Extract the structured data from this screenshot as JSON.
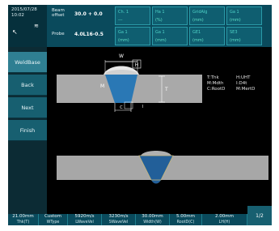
{
  "header": {
    "date": "2015/07/28",
    "time": "10:02",
    "beam_offset_label": "Beam\noffset",
    "beam_offset_value": "30.0 + 0.0",
    "probe_label": "Probe",
    "probe_value": "4.0L16-0.5",
    "tiles": [
      {
        "title": "Ch. 1",
        "value": "---"
      },
      {
        "title": "Ha 1",
        "value": "(%)"
      },
      {
        "title": "GridAlg",
        "value": "(mm)"
      },
      {
        "title": "Ga 1",
        "value": "(mm)"
      },
      {
        "title": "Ga 1",
        "value": "(mm)"
      },
      {
        "title": "Ga 1",
        "value": "(mm)"
      },
      {
        "title": "GE1",
        "value": "(mm)"
      },
      {
        "title": "SE3",
        "value": "(mm)"
      }
    ]
  },
  "sidebar": {
    "items": [
      {
        "label": "WeldBase"
      },
      {
        "label": "Back"
      },
      {
        "label": "Next"
      },
      {
        "label": "Finish"
      }
    ]
  },
  "diagram": {
    "labels": {
      "w": "W",
      "h": "H",
      "m": "M",
      "t": "T",
      "c": "C",
      "i": "I"
    },
    "legend": {
      "left": [
        "T:Thk",
        "M:Mdth",
        "C:RootD"
      ],
      "right": [
        "H:UHT",
        "I:D4t",
        "M:MertD"
      ]
    }
  },
  "bottom": {
    "cells": [
      {
        "value": "21.00mm",
        "key": "Thk(T)"
      },
      {
        "value": "Custom",
        "key": "WType"
      },
      {
        "value": "5920m/s",
        "key": "LWaveVel"
      },
      {
        "value": "3230m/s",
        "key": "SWaveVel"
      },
      {
        "value": "30.00mm",
        "key": "Width(W)"
      },
      {
        "value": "5.00mm",
        "key": "RootD(C)"
      },
      {
        "value": "2.00mm",
        "key": "LH(H)"
      }
    ],
    "page": "1/2"
  },
  "colors": {
    "accent": "#0a4a5c",
    "button": "#175f70",
    "weld": "#2a78b5",
    "plate": "#a9a9a9"
  }
}
